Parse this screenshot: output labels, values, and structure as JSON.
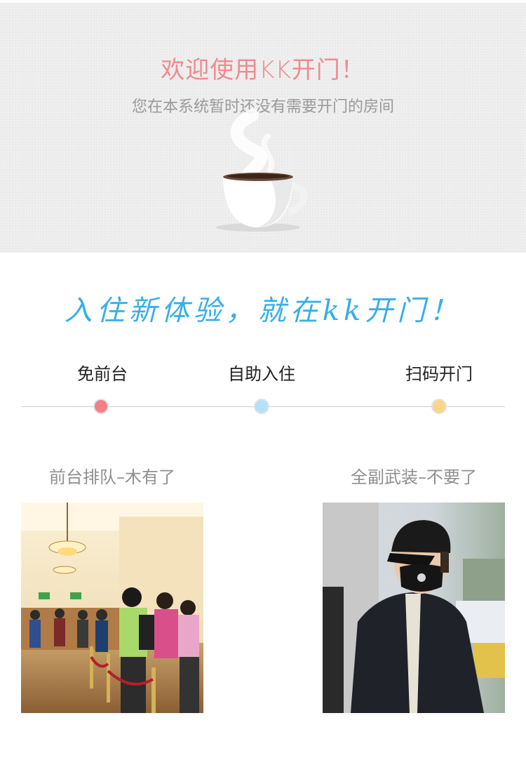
{
  "hero": {
    "title": "欢迎使用KK开门！",
    "subtitle": "您在本系统暂时还没有需要开门的房间"
  },
  "slogan": "入住新体验，就在kk开门！",
  "steps": [
    {
      "label": "免前台",
      "color": "#f47f86"
    },
    {
      "label": "自助入住",
      "color": "#b6e0f7"
    },
    {
      "label": "扫码开门",
      "color": "#fbd58a"
    }
  ],
  "cards": [
    {
      "caption": "前台排队–木有了",
      "image": "hotel-lobby-queue-photo"
    },
    {
      "caption": "全副武装–不要了",
      "image": "masked-person-photo"
    }
  ],
  "colors": {
    "accent_pink": "#f08a8f",
    "accent_blue": "#38aee8",
    "hero_bg": "#efefef"
  }
}
